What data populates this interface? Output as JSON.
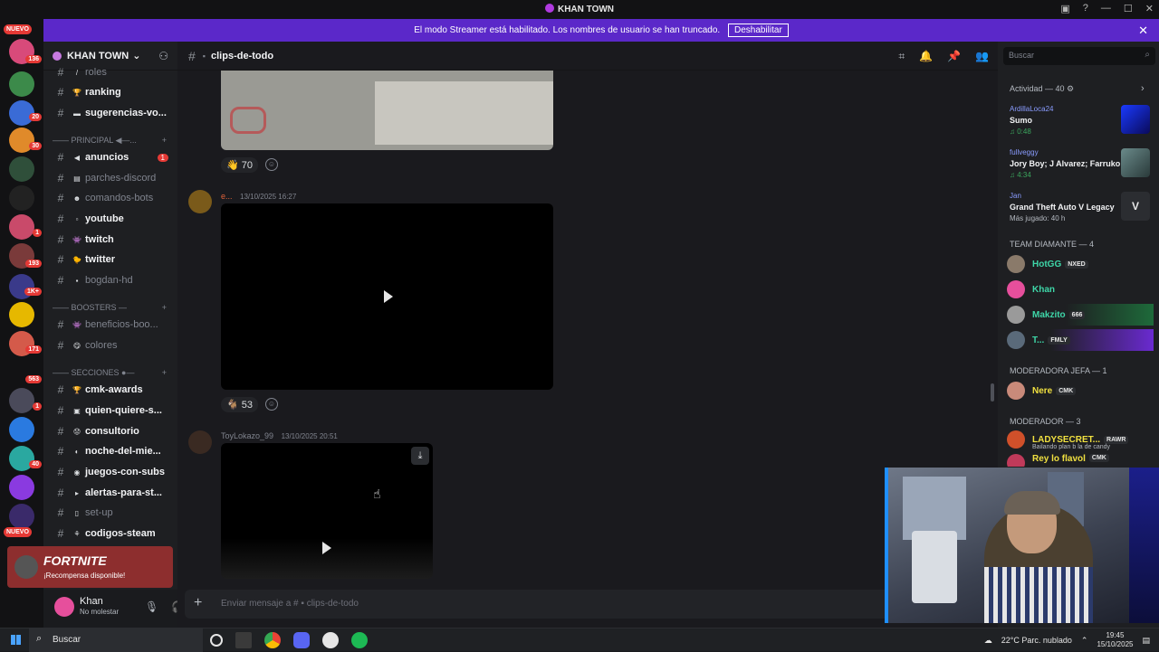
{
  "window": {
    "title": "KHAN TOWN"
  },
  "streamer_bar": {
    "text": "El modo Streamer está habilitado. Los nombres de usuario se han truncado.",
    "button": "Deshabilitar"
  },
  "rail": {
    "nuevo_top": "NUEVO",
    "nuevo_bottom": "NUEVO",
    "badges": [
      "136",
      "20",
      "30",
      "1",
      "193",
      "1K+",
      "171",
      "563",
      "1",
      "40"
    ]
  },
  "server": {
    "name": "KHAN TOWN"
  },
  "channels": {
    "roles": "roles",
    "ranking": "ranking",
    "sugerencias": "sugerencias-vo...",
    "cat_principal": "—— PRINCIPAL ◀—...",
    "anuncios": "anuncios",
    "anuncios_count": "1",
    "parches": "parches-discord",
    "comandos": "comandos-bots",
    "youtube": "youtube",
    "twitch": "twitch",
    "twitter": "twitter",
    "bogdan": "bogdan-hd",
    "cat_boosters": "—— BOOSTERS —",
    "beneficios": "beneficios-boo...",
    "colores": "colores",
    "cat_secciones": "—— SECCIONES ●—",
    "cmk": "cmk-awards",
    "quien": "quien-quiere-s...",
    "consultorio": "consultorio",
    "noche": "noche-del-mie...",
    "juegos": "juegos-con-subs",
    "alertas": "alertas-para-st...",
    "setup": "set-up",
    "codigos": "codigos-steam"
  },
  "promo": {
    "title": "FORTNITE",
    "sub": "¡Recompensa disponible!"
  },
  "user": {
    "name": "Khan",
    "status": "No molestar"
  },
  "main": {
    "channel": "clips-de-todo",
    "reaction1_count": "70",
    "msg2_author": "e...",
    "msg2_time": "13/10/2025 16:27",
    "reaction2_count": "53",
    "msg3_author": "ToyLokazo_99",
    "msg3_time": "13/10/2025 20:51",
    "composer_placeholder": "Enviar mensaje a # ▪ clips-de-todo"
  },
  "search": {
    "placeholder": "Buscar"
  },
  "activity": {
    "header": "Actividad — 40",
    "items": [
      {
        "user": "ArdillaLoca24",
        "title": "Sumo",
        "meta": "♫ 0:48"
      },
      {
        "user": "fullveggy",
        "title": "Jory Boy; J Alvarez; Farruko",
        "meta": "♫ 4:34"
      },
      {
        "user": "Jan",
        "title": "Grand Theft Auto V Legacy",
        "meta": "Más jugado: 40 h"
      }
    ]
  },
  "members": {
    "team_header": "TEAM DIAMANTE — 4",
    "hotgg": "HotGG",
    "hotgg_tag": "NXED",
    "khan": "Khan",
    "makzito": "Makzito",
    "makzito_tag": "666",
    "t": "T...",
    "t_tag": "FMLY",
    "mod_jefa_header": "MODERADORA JEFA — 1",
    "nere": "Nere",
    "nere_tag": "CMK",
    "mod_header": "MODERADOR — 3",
    "lady": "LADYSECRET...",
    "lady_tag": "RAWR",
    "lady_sub": "Bailando plan b la de candy",
    "rey": "Rey lo flavol",
    "rey_tag": "CMK"
  },
  "taskbar": {
    "search": "Buscar",
    "weather": "22°C  Parc. nublado",
    "time": "19:45",
    "date": "15/10/2025"
  }
}
